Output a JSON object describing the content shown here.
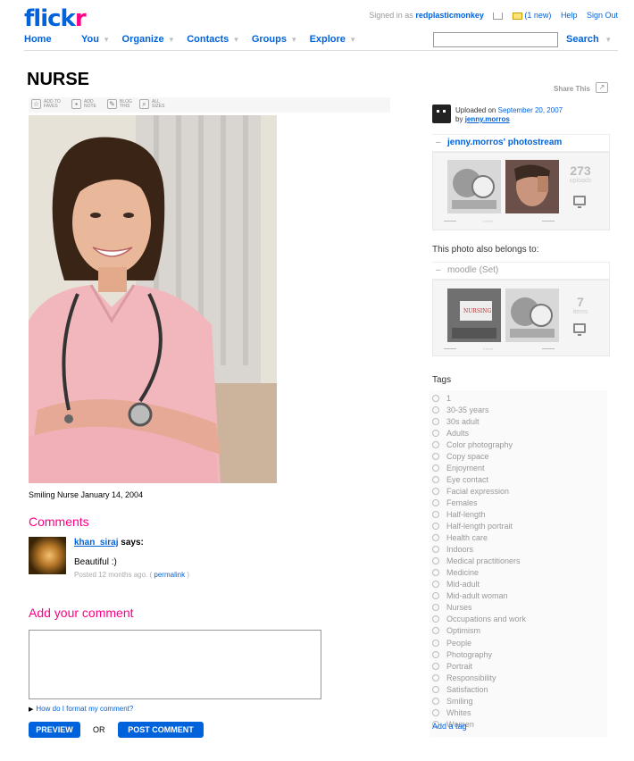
{
  "header": {
    "logo_primary": "flick",
    "logo_accent": "r",
    "signed_in_prefix": "Signed in as",
    "username": "redplasticmonkey",
    "mail_count": "(1 new)",
    "help": "Help",
    "sign_out": "Sign Out",
    "nav": [
      "Home",
      "You",
      "Organize",
      "Contacts",
      "Groups",
      "Explore"
    ],
    "search_label": "Search",
    "search_value": ""
  },
  "photo": {
    "title": "NURSE",
    "share_this": "Share This",
    "toolbar": [
      {
        "icon": "star-icon",
        "label": "Add to faves"
      },
      {
        "icon": "note-icon",
        "label": "Add note"
      },
      {
        "icon": "blog-icon",
        "label": "Blog this"
      },
      {
        "icon": "magnifier-icon",
        "label": "All sizes"
      }
    ],
    "caption": "Smiling Nurse January 14, 2004"
  },
  "comments": {
    "heading": "Comments",
    "items": [
      {
        "user": "khan_siraj",
        "says": "says:",
        "text": "Beautiful :)",
        "meta_prefix": "Posted 12 months ago. (",
        "permalink": "permalink",
        "meta_suffix": ")"
      }
    ],
    "add_heading": "Add your comment",
    "textarea_value": "",
    "format_help": "How do I format my comment?",
    "preview": "PREVIEW",
    "or": "OR",
    "post": "POST COMMENT"
  },
  "sidebar": {
    "uploaded_prefix": "Uploaded on",
    "uploaded_date": "September 20, 2007",
    "by_prefix": "by",
    "owner": "jenny.morros",
    "photostream": {
      "title": "jenny.morros' photostream",
      "count": "273",
      "unit": "uploads"
    },
    "belongs_to": "This photo also belongs to:",
    "set": {
      "title": "moodle (Set)",
      "count": "7",
      "unit": "items"
    }
  },
  "tags": {
    "heading": "Tags",
    "items": [
      "1",
      "30-35 years",
      "30s adult",
      "Adults",
      "Color photography",
      "Copy space",
      "Enjoyment",
      "Eye contact",
      "Facial expression",
      "Females",
      "Half-length",
      "Half-length portrait",
      "Health care",
      "Indoors",
      "Medical practitioners",
      "Medicine",
      "Mid-adult",
      "Mid-adult woman",
      "Nurses",
      "Occupations and work",
      "Optimism",
      "People",
      "Photography",
      "Portrait",
      "Responsibility",
      "Satisfaction",
      "Smiling",
      "Whites",
      "Women"
    ],
    "add_tag": "Add a tag"
  },
  "colors": {
    "brand_blue": "#0063dc",
    "brand_pink": "#ff0084"
  }
}
